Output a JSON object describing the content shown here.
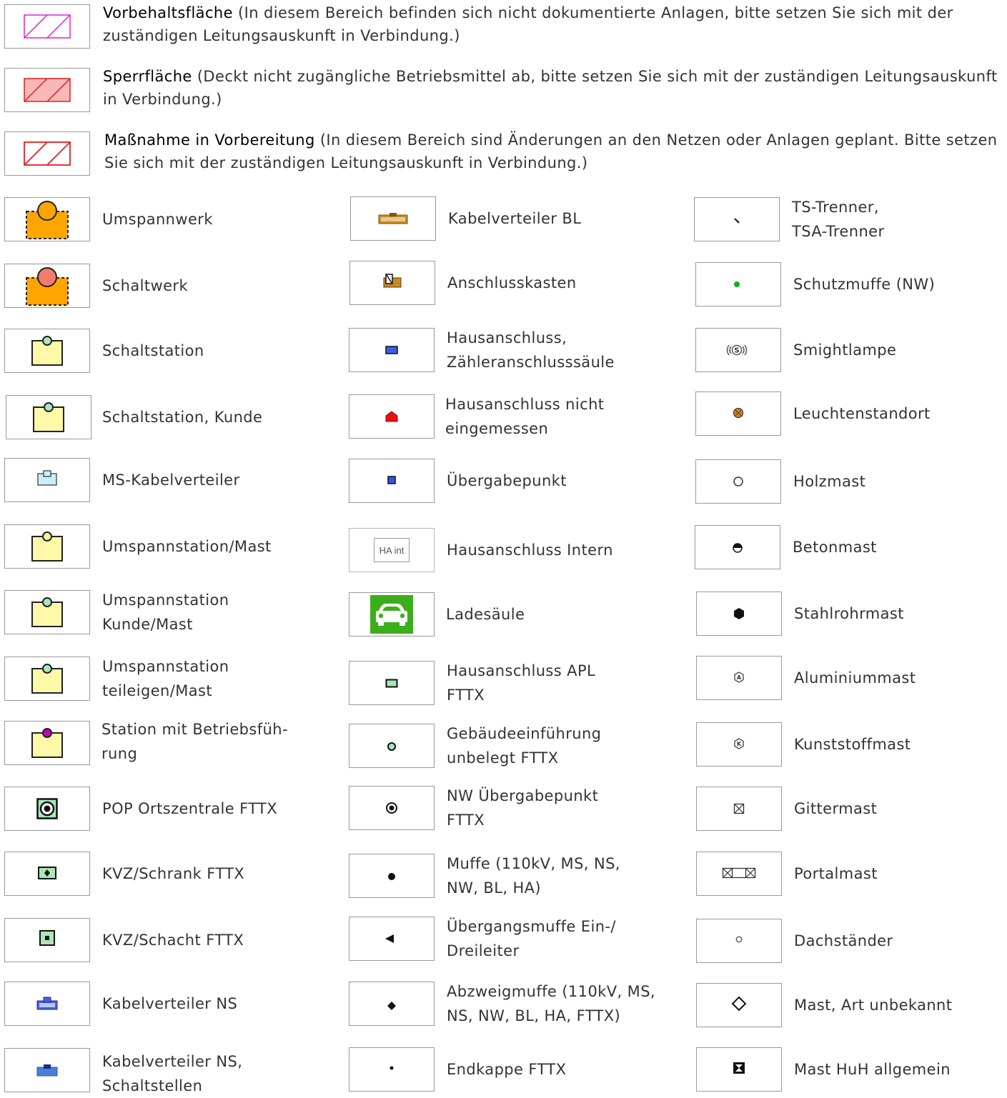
{
  "areas": [
    {
      "title": "Vorbehaltsfläche",
      "text": " (In diesem Bereich befinden sich nicht dokumentierte Anlagen, bitte setzen Sie sich mit der zuständigen Leitungsauskunft in Verbindung.)"
    },
    {
      "title": "Sperrfläche",
      "text": " (Deckt nicht zugängliche Betriebsmittel ab, bitte setzen Sie sich mit der zuständigen Leitungs­auskunft in Verbindung.)"
    },
    {
      "title": "Maßnahme in Vorbereitung",
      "text": " (In diesem Bereich sind Änderungen an den Netzen oder Anlagen geplant. Bitte setzen Sie sich mit der zuständigen Leitungsauskunft in Verbindung.)"
    }
  ],
  "columns": [
    [
      {
        "label": "Umspannwerk",
        "icon": "substation-orange-icon"
      },
      {
        "label": "Schaltwerk",
        "icon": "switchgear-orange-icon"
      },
      {
        "label": "Schaltstation",
        "icon": "switching-station-icon"
      },
      {
        "label": "Schaltstation, Kunde",
        "icon": "switching-station-customer-icon"
      },
      {
        "label": "MS-Kabelverteiler",
        "icon": "ms-cable-distributor-icon"
      },
      {
        "label": "Umspannstation/Mast",
        "icon": "transformer-station-mast-icon"
      },
      {
        "label": "Umspannstation\nKunde/Mast",
        "icon": "transformer-station-customer-icon"
      },
      {
        "label": "Umspannstation\nteileigen/Mast",
        "icon": "transformer-station-partial-icon"
      },
      {
        "label": "Station mit Betriebsfüh-\nrung",
        "icon": "station-operation-icon"
      },
      {
        "label": "POP Ortszentrale FTTX",
        "icon": "pop-central-icon"
      },
      {
        "label": "KVZ/Schrank FTTX",
        "icon": "kvz-cabinet-icon"
      },
      {
        "label": "KVZ/Schacht FTTX",
        "icon": "kvz-shaft-icon"
      },
      {
        "label": "Kabelverteiler NS",
        "icon": "cable-distributor-ns-icon"
      },
      {
        "label": "Kabelverteiler NS,\nSchaltstellen",
        "icon": "cable-distributor-ns-switch-icon"
      }
    ],
    [
      {
        "label": "Kabelverteiler BL",
        "icon": "cable-distributor-bl-icon"
      },
      {
        "label": "Anschlusskasten",
        "icon": "connection-box-icon"
      },
      {
        "label": "Hausanschluss,\nZähleranschlusssäule",
        "icon": "house-connection-icon"
      },
      {
        "label": "Hausanschluss nicht\neingemessen",
        "icon": "house-connection-unmeasured-icon"
      },
      {
        "label": "Übergabepunkt",
        "icon": "transfer-point-icon"
      },
      {
        "label": "Hausanschluss Intern",
        "icon": "house-connection-internal-icon",
        "icon_text": "HA int"
      },
      {
        "label": "Ladesäule",
        "icon": "charging-station-car-icon"
      },
      {
        "label": "Hausanschluss APL\nFTTX",
        "icon": "house-connection-apl-icon"
      },
      {
        "label": "Gebäudeeinführung\nunbelegt FTTX",
        "icon": "building-entry-icon"
      },
      {
        "label": "NW Übergabepunkt\nFTTX",
        "icon": "nw-transfer-point-icon"
      },
      {
        "label": "Muffe (110kV, MS, NS,\nNW, BL, HA)",
        "icon": "sleeve-dot-icon"
      },
      {
        "label": "Übergangsmuffe Ein-/\nDreileiter",
        "icon": "transition-sleeve-triangle-icon"
      },
      {
        "label": "Abzweigmuffe (110kV, MS,\nNS, NW, BL, HA, FTTX)",
        "icon": "branch-sleeve-diamond-icon"
      },
      {
        "label": "Endkappe FTTX",
        "icon": "end-cap-icon"
      }
    ],
    [
      {
        "label": "TS-Trenner,\nTSA-Trenner",
        "icon": "disconnector-icon"
      },
      {
        "label": "Schutzmuffe (NW)",
        "icon": "protective-sleeve-icon"
      },
      {
        "label": "Smightlampe",
        "icon": "smight-lamp-icon"
      },
      {
        "label": "Leuchtenstandort",
        "icon": "light-location-icon"
      },
      {
        "label": "Holzmast",
        "icon": "wooden-mast-icon"
      },
      {
        "label": "Betonmast",
        "icon": "concrete-mast-icon"
      },
      {
        "label": "Stahlrohrmast",
        "icon": "steel-tube-mast-icon"
      },
      {
        "label": "Aluminiummast",
        "icon": "aluminium-mast-icon"
      },
      {
        "label": "Kunststoffmast",
        "icon": "plastic-mast-icon"
      },
      {
        "label": "Gittermast",
        "icon": "lattice-mast-icon"
      },
      {
        "label": "Portalmast",
        "icon": "portal-mast-icon"
      },
      {
        "label": "Dachständer",
        "icon": "roof-stand-icon"
      },
      {
        "label": "Mast, Art unbekannt",
        "icon": "unknown-mast-icon"
      },
      {
        "label": "Mast HuH allgemein",
        "icon": "mast-huh-icon"
      }
    ]
  ]
}
